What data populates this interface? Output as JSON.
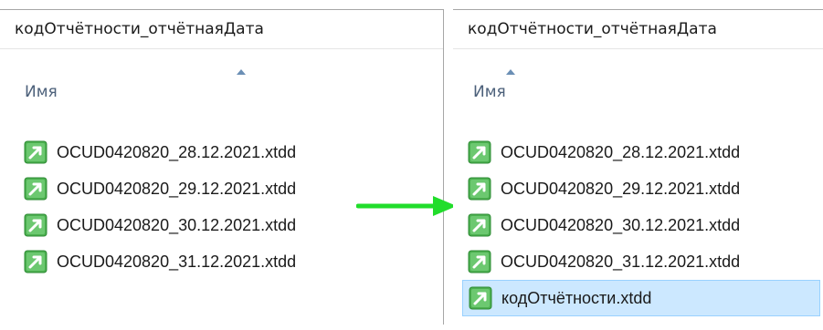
{
  "colors": {
    "accent_green": "#21dd2b",
    "icon_green": "#4cb050",
    "selection_bg": "#cce8ff",
    "header_text": "#4c607a"
  },
  "left_pane": {
    "title": "кодОтчётности_отчётнаяДата",
    "column_header": "Имя",
    "sort_indicator": "sort-ascending-icon",
    "files": [
      {
        "name": "OCUD0420820_28.12.2021.xtdd",
        "icon": "xtdd-file-icon"
      },
      {
        "name": "OCUD0420820_29.12.2021.xtdd",
        "icon": "xtdd-file-icon"
      },
      {
        "name": "OCUD0420820_30.12.2021.xtdd",
        "icon": "xtdd-file-icon"
      },
      {
        "name": "OCUD0420820_31.12.2021.xtdd",
        "icon": "xtdd-file-icon"
      }
    ]
  },
  "right_pane": {
    "title": "кодОтчётности_отчётнаяДата",
    "column_header": "Имя",
    "sort_indicator": "sort-ascending-icon",
    "files": [
      {
        "name": "OCUD0420820_28.12.2021.xtdd",
        "icon": "xtdd-file-icon"
      },
      {
        "name": "OCUD0420820_29.12.2021.xtdd",
        "icon": "xtdd-file-icon"
      },
      {
        "name": "OCUD0420820_30.12.2021.xtdd",
        "icon": "xtdd-file-icon"
      },
      {
        "name": "OCUD0420820_31.12.2021.xtdd",
        "icon": "xtdd-file-icon"
      },
      {
        "name": "кодОтчётности.xtdd",
        "icon": "xtdd-file-icon",
        "selected": true
      }
    ]
  },
  "transition_arrow": "right-arrow-icon"
}
